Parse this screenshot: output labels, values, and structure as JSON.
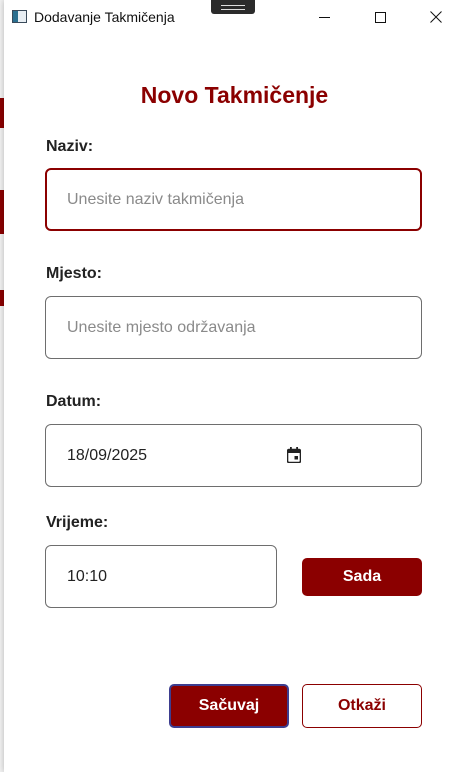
{
  "window": {
    "title": "Dodavanje Takmičenja"
  },
  "form": {
    "heading": "Novo Takmičenje",
    "naziv": {
      "label": "Naziv:",
      "value": "",
      "placeholder": "Unesite naziv takmičenja"
    },
    "mjesto": {
      "label": "Mjesto:",
      "value": "",
      "placeholder": "Unesite mjesto održavanja"
    },
    "datum": {
      "label": "Datum:",
      "value": "18/09/2025"
    },
    "vrijeme": {
      "label": "Vrijeme:",
      "value": "10:10",
      "now_button": "Sada"
    }
  },
  "actions": {
    "save": "Sačuvaj",
    "cancel": "Otkaži"
  },
  "colors": {
    "accent": "#8b0000",
    "focus_outline": "#3d3d8f"
  }
}
